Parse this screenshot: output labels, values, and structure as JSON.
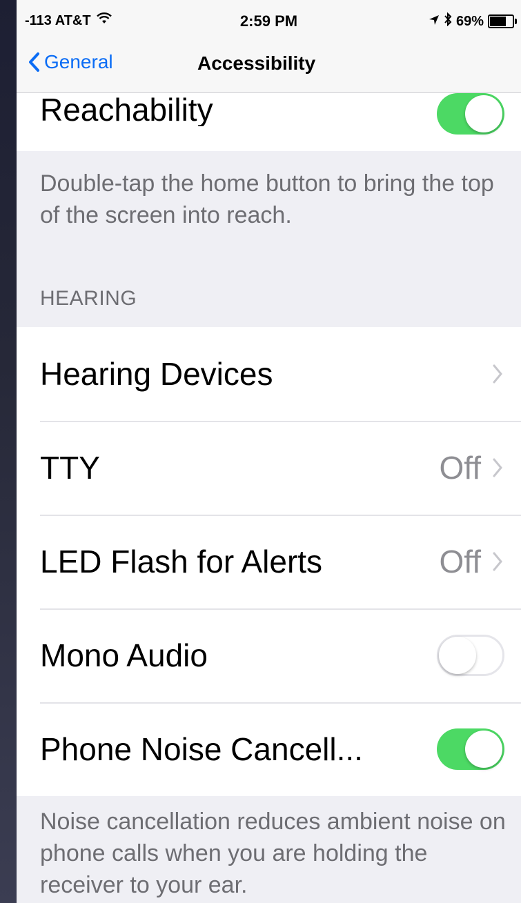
{
  "status_bar": {
    "carrier": "-113 AT&T",
    "time": "2:59 PM",
    "battery": "69%",
    "battery_level": 0.69
  },
  "nav": {
    "back_label": "General",
    "title": "Accessibility"
  },
  "reachability": {
    "label": "Reachability",
    "toggle_on": true,
    "footer": "Double-tap the home button to bring the top of the screen into reach."
  },
  "hearing": {
    "header": "HEARING",
    "items": [
      {
        "label": "Hearing Devices",
        "value": ""
      },
      {
        "label": "TTY",
        "value": "Off"
      },
      {
        "label": "LED Flash for Alerts",
        "value": "Off"
      },
      {
        "label": "Mono Audio",
        "toggle_on": false
      },
      {
        "label": "Phone Noise Cancell...",
        "toggle_on": true
      }
    ],
    "footer": "Noise cancellation reduces ambient noise on phone calls when you are holding the receiver to your ear."
  },
  "colors": {
    "accent": "#0a6cf5",
    "toggle_on": "#4cd964",
    "background": "#efeff4"
  }
}
